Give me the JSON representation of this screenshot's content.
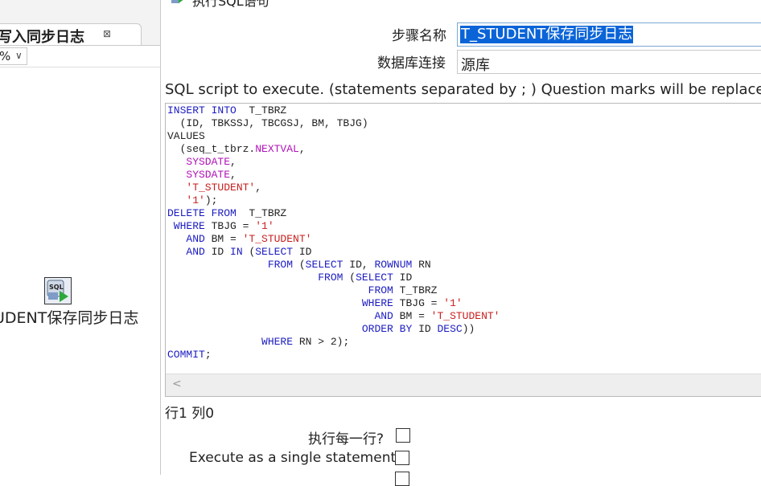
{
  "left_panel": {
    "tab_label": "写入同步日志",
    "tab_close": "⊠",
    "zoom": "%",
    "step_icon": "sql-script-icon",
    "step_label": "UDENT保存同步日志"
  },
  "dialog": {
    "title": "执行SQL语句",
    "step_name_label": "步骤名称",
    "step_name_value": "T_STUDENT保存同步日志",
    "connection_label": "数据库连接",
    "connection_value": "源库",
    "sql_description": "SQL script to execute. (statements separated by ; ) Question marks will be replaced by",
    "position": "行1 列0",
    "option1_label": "执行每一行?",
    "option2_label": "Execute as a single statement",
    "option1_checked": false,
    "option2_checked": false
  },
  "sql_lines": [
    [
      [
        "kw",
        "INSERT INTO"
      ],
      [
        "",
        "  T_TBRZ"
      ]
    ],
    [
      [
        "",
        "  (ID, TBKSSJ, TBCGSJ, BM, TBJG)"
      ]
    ],
    [
      [
        "",
        "VALUES"
      ]
    ],
    [
      [
        "",
        "  (seq_t_tbrz."
      ],
      [
        "fn",
        "NEXTVAL"
      ],
      [
        "",
        ","
      ]
    ],
    [
      [
        "",
        "   "
      ],
      [
        "fn",
        "SYSDATE"
      ],
      [
        "",
        ","
      ]
    ],
    [
      [
        "",
        "   "
      ],
      [
        "fn",
        "SYSDATE"
      ],
      [
        "",
        ","
      ]
    ],
    [
      [
        "",
        "   "
      ],
      [
        "str",
        "'T_STUDENT'"
      ],
      [
        "",
        ","
      ]
    ],
    [
      [
        "",
        "   "
      ],
      [
        "str",
        "'1'"
      ],
      [
        "",
        ");"
      ]
    ],
    [
      [
        "kw",
        "DELETE FROM"
      ],
      [
        "",
        ""
      ],
      [
        "",
        "  T_TBRZ"
      ]
    ],
    [
      [
        "",
        ""
      ],
      [
        "kw",
        " WHERE"
      ],
      [
        "",
        " TBJG = "
      ],
      [
        "str",
        "'1'"
      ]
    ],
    [
      [
        "",
        "   "
      ],
      [
        "kw",
        "AND"
      ],
      [
        "",
        " BM = "
      ],
      [
        "str",
        "'T_STUDENT'"
      ]
    ],
    [
      [
        "",
        "   "
      ],
      [
        "kw",
        "AND"
      ],
      [
        "",
        " ID "
      ],
      [
        "kw",
        "IN"
      ],
      [
        "",
        " ("
      ],
      [
        "kw",
        "SELECT"
      ],
      [
        "",
        " ID"
      ]
    ],
    [
      [
        "",
        "                "
      ],
      [
        "kw",
        "FROM"
      ],
      [
        "",
        " ("
      ],
      [
        "kw",
        "SELECT"
      ],
      [
        "",
        " ID, "
      ],
      [
        "kw",
        "ROWNUM"
      ],
      [
        "",
        " RN"
      ]
    ],
    [
      [
        "",
        "                        "
      ],
      [
        "kw",
        "FROM"
      ],
      [
        "",
        " ("
      ],
      [
        "kw",
        "SELECT"
      ],
      [
        "",
        " ID"
      ]
    ],
    [
      [
        "",
        "                                "
      ],
      [
        "kw",
        "FROM"
      ],
      [
        "",
        " T_TBRZ"
      ]
    ],
    [
      [
        "",
        "                               "
      ],
      [
        "kw",
        "WHERE"
      ],
      [
        "",
        " TBJG = "
      ],
      [
        "str",
        "'1'"
      ]
    ],
    [
      [
        "",
        "                                 "
      ],
      [
        "kw",
        "AND"
      ],
      [
        "",
        " BM = "
      ],
      [
        "str",
        "'T_STUDENT'"
      ]
    ],
    [
      [
        "",
        "                               "
      ],
      [
        "kw",
        "ORDER BY"
      ],
      [
        "",
        " ID "
      ],
      [
        "kw",
        "DESC"
      ],
      [
        "",
        "))"
      ]
    ],
    [
      [
        "",
        "               "
      ],
      [
        "kw",
        "WHERE"
      ],
      [
        "",
        " RN > 2);"
      ]
    ],
    [
      [
        "kw",
        "COMMIT"
      ],
      [
        "",
        ";"
      ]
    ]
  ]
}
